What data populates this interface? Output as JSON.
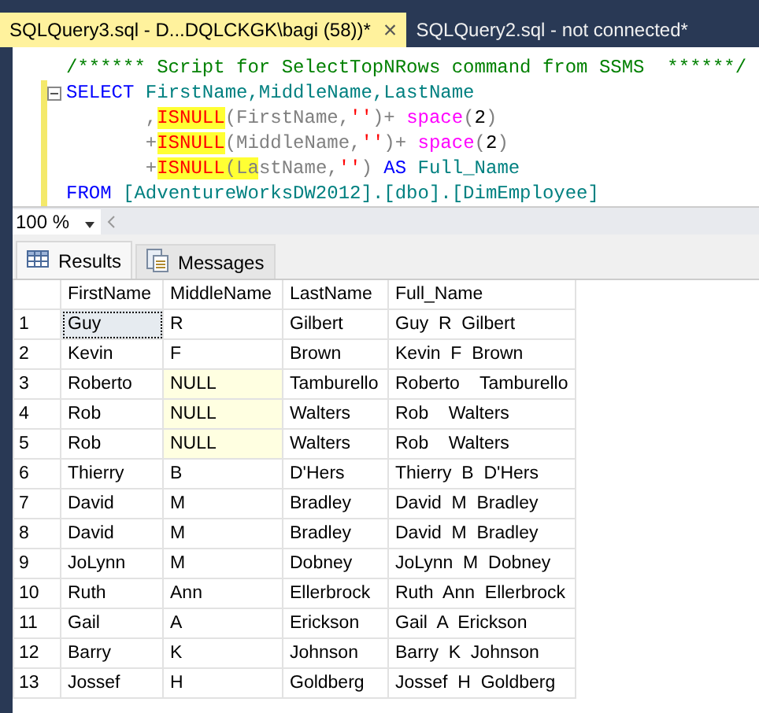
{
  "doc_tabs": [
    {
      "label": "SQLQuery3.sql - D...DQLCKGK\\bagi (58))*",
      "selected": true,
      "close": "×"
    },
    {
      "label": "SQLQuery2.sql - not connected*",
      "selected": false
    }
  ],
  "editor": {
    "lines": [
      {
        "fold": false,
        "changed": false,
        "tokens": [
          {
            "text": "/****** Script for SelectTopNRows command from SSMS  ******/",
            "kind": "comment"
          }
        ]
      },
      {
        "fold": true,
        "changed": true,
        "tokens": [
          {
            "text": "SELECT",
            "kind": "keyword"
          },
          {
            "text": " FirstName,MiddleName,LastName",
            "kind": "ident"
          }
        ]
      },
      {
        "fold": false,
        "changed": true,
        "tokens": [
          {
            "text": "       ,",
            "kind": "plain"
          },
          {
            "text": "ISNULL",
            "kind": "function",
            "highlighted": true
          },
          {
            "text": "(FirstName,",
            "kind": "plain"
          },
          {
            "text": "''",
            "kind": "string"
          },
          {
            "text": ")+ ",
            "kind": "plain"
          },
          {
            "text": "space",
            "kind": "builtin"
          },
          {
            "text": "(",
            "kind": "plain"
          },
          {
            "text": "2",
            "kind": "number"
          },
          {
            "text": ")",
            "kind": "plain"
          }
        ]
      },
      {
        "fold": false,
        "changed": true,
        "tokens": [
          {
            "text": "       +",
            "kind": "plain"
          },
          {
            "text": "ISNULL",
            "kind": "function",
            "highlighted": true
          },
          {
            "text": "(MiddleName,",
            "kind": "plain"
          },
          {
            "text": "''",
            "kind": "string"
          },
          {
            "text": ")+ ",
            "kind": "plain"
          },
          {
            "text": "space",
            "kind": "builtin"
          },
          {
            "text": "(",
            "kind": "plain"
          },
          {
            "text": "2",
            "kind": "number"
          },
          {
            "text": ")",
            "kind": "plain"
          }
        ]
      },
      {
        "fold": false,
        "changed": true,
        "tokens": [
          {
            "text": "       +",
            "kind": "plain"
          },
          {
            "text": "ISNULL",
            "kind": "function",
            "highlighted": true
          },
          {
            "text": "(La",
            "kind": "plain",
            "highlighted": true
          },
          {
            "text": "stName,",
            "kind": "plain"
          },
          {
            "text": "''",
            "kind": "string"
          },
          {
            "text": ") ",
            "kind": "plain"
          },
          {
            "text": "AS",
            "kind": "keyword"
          },
          {
            "text": " Full_Name",
            "kind": "ident"
          }
        ]
      },
      {
        "fold": false,
        "changed": true,
        "tokens": [
          {
            "text": "FROM",
            "kind": "keyword"
          },
          {
            "text": " [AdventureWorksDW2012].[dbo].[DimEmployee]",
            "kind": "ident"
          }
        ]
      }
    ]
  },
  "zoom": {
    "value": "100 %"
  },
  "result_tabs": [
    {
      "label": "Results",
      "kind": "grid",
      "selected": true
    },
    {
      "label": "Messages",
      "kind": "messages",
      "selected": false
    }
  ],
  "table": {
    "columns": [
      "FirstName",
      "MiddleName",
      "LastName",
      "Full_Name"
    ],
    "rows": [
      {
        "number": "1",
        "cells": [
          {
            "text": "Guy",
            "is_null": false,
            "selected": true
          },
          {
            "text": "R",
            "is_null": false,
            "selected": false
          },
          {
            "text": "Gilbert",
            "is_null": false,
            "selected": false
          },
          {
            "text": "Guy  R  Gilbert",
            "is_null": false,
            "selected": false
          }
        ]
      },
      {
        "number": "2",
        "cells": [
          {
            "text": "Kevin",
            "is_null": false,
            "selected": false
          },
          {
            "text": "F",
            "is_null": false,
            "selected": false
          },
          {
            "text": "Brown",
            "is_null": false,
            "selected": false
          },
          {
            "text": "Kevin  F  Brown",
            "is_null": false,
            "selected": false
          }
        ]
      },
      {
        "number": "3",
        "cells": [
          {
            "text": "Roberto",
            "is_null": false,
            "selected": false
          },
          {
            "text": "NULL",
            "is_null": true,
            "selected": false
          },
          {
            "text": "Tamburello",
            "is_null": false,
            "selected": false
          },
          {
            "text": "Roberto    Tamburello",
            "is_null": false,
            "selected": false
          }
        ]
      },
      {
        "number": "4",
        "cells": [
          {
            "text": "Rob",
            "is_null": false,
            "selected": false
          },
          {
            "text": "NULL",
            "is_null": true,
            "selected": false
          },
          {
            "text": "Walters",
            "is_null": false,
            "selected": false
          },
          {
            "text": "Rob    Walters",
            "is_null": false,
            "selected": false
          }
        ]
      },
      {
        "number": "5",
        "cells": [
          {
            "text": "Rob",
            "is_null": false,
            "selected": false
          },
          {
            "text": "NULL",
            "is_null": true,
            "selected": false
          },
          {
            "text": "Walters",
            "is_null": false,
            "selected": false
          },
          {
            "text": "Rob    Walters",
            "is_null": false,
            "selected": false
          }
        ]
      },
      {
        "number": "6",
        "cells": [
          {
            "text": "Thierry",
            "is_null": false,
            "selected": false
          },
          {
            "text": "B",
            "is_null": false,
            "selected": false
          },
          {
            "text": "D'Hers",
            "is_null": false,
            "selected": false
          },
          {
            "text": "Thierry  B  D'Hers",
            "is_null": false,
            "selected": false
          }
        ]
      },
      {
        "number": "7",
        "cells": [
          {
            "text": "David",
            "is_null": false,
            "selected": false
          },
          {
            "text": "M",
            "is_null": false,
            "selected": false
          },
          {
            "text": "Bradley",
            "is_null": false,
            "selected": false
          },
          {
            "text": "David  M  Bradley",
            "is_null": false,
            "selected": false
          }
        ]
      },
      {
        "number": "8",
        "cells": [
          {
            "text": "David",
            "is_null": false,
            "selected": false
          },
          {
            "text": "M",
            "is_null": false,
            "selected": false
          },
          {
            "text": "Bradley",
            "is_null": false,
            "selected": false
          },
          {
            "text": "David  M  Bradley",
            "is_null": false,
            "selected": false
          }
        ]
      },
      {
        "number": "9",
        "cells": [
          {
            "text": "JoLynn",
            "is_null": false,
            "selected": false
          },
          {
            "text": "M",
            "is_null": false,
            "selected": false
          },
          {
            "text": "Dobney",
            "is_null": false,
            "selected": false
          },
          {
            "text": "JoLynn  M  Dobney",
            "is_null": false,
            "selected": false
          }
        ]
      },
      {
        "number": "10",
        "cells": [
          {
            "text": "Ruth",
            "is_null": false,
            "selected": false
          },
          {
            "text": "Ann",
            "is_null": false,
            "selected": false
          },
          {
            "text": "Ellerbrock",
            "is_null": false,
            "selected": false
          },
          {
            "text": "Ruth  Ann  Ellerbrock",
            "is_null": false,
            "selected": false
          }
        ]
      },
      {
        "number": "11",
        "cells": [
          {
            "text": "Gail",
            "is_null": false,
            "selected": false
          },
          {
            "text": "A",
            "is_null": false,
            "selected": false
          },
          {
            "text": "Erickson",
            "is_null": false,
            "selected": false
          },
          {
            "text": "Gail  A  Erickson",
            "is_null": false,
            "selected": false
          }
        ]
      },
      {
        "number": "12",
        "cells": [
          {
            "text": "Barry",
            "is_null": false,
            "selected": false
          },
          {
            "text": "K",
            "is_null": false,
            "selected": false
          },
          {
            "text": "Johnson",
            "is_null": false,
            "selected": false
          },
          {
            "text": "Barry  K  Johnson",
            "is_null": false,
            "selected": false
          }
        ]
      },
      {
        "number": "13",
        "cells": [
          {
            "text": "Jossef",
            "is_null": false,
            "selected": false
          },
          {
            "text": "H",
            "is_null": false,
            "selected": false
          },
          {
            "text": "Goldberg",
            "is_null": false,
            "selected": false
          },
          {
            "text": "Jossef  H  Goldberg",
            "is_null": false,
            "selected": false
          }
        ]
      }
    ]
  }
}
